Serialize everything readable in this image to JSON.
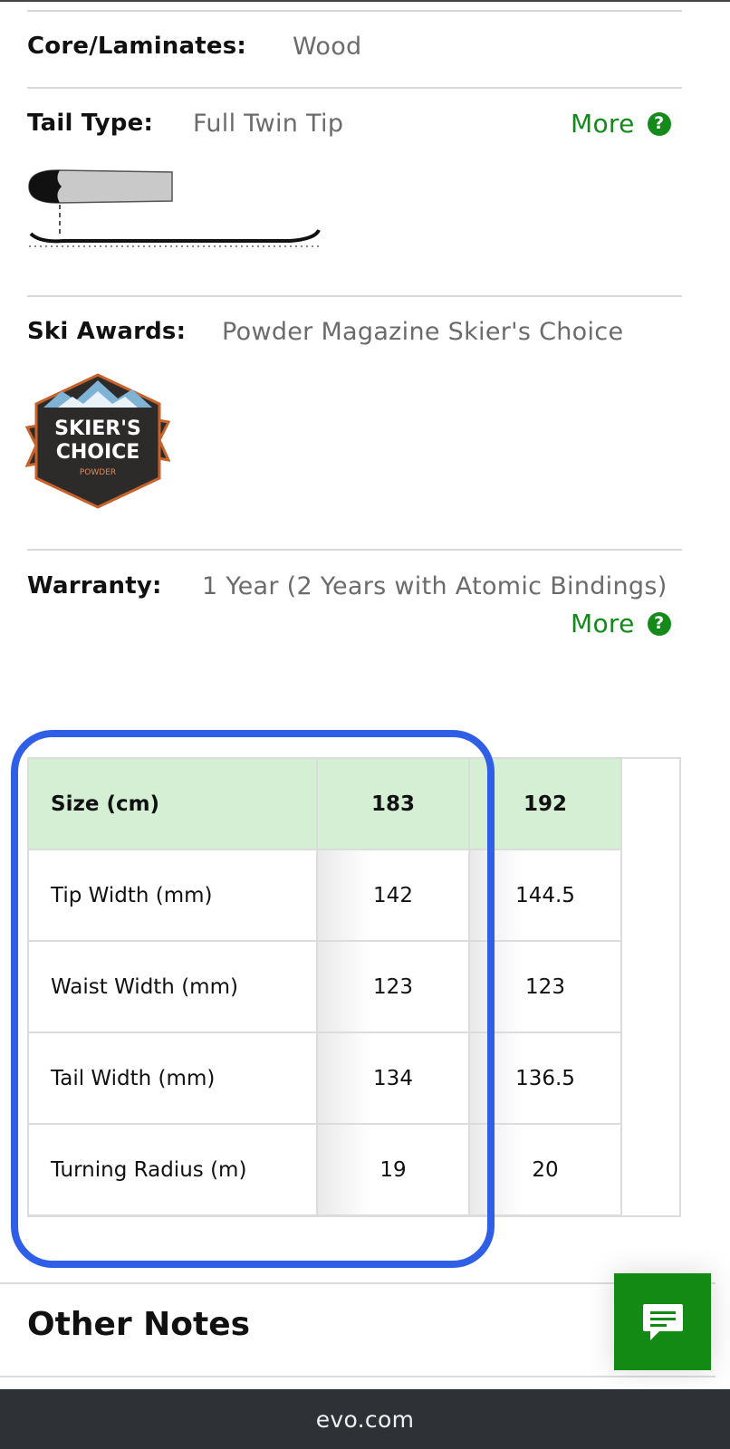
{
  "specs": {
    "core": {
      "label": "Core/Laminates:",
      "value": "Wood"
    },
    "tail": {
      "label": "Tail Type:",
      "value": "Full Twin Tip",
      "more": "More"
    },
    "awards": {
      "label": "Ski Awards:",
      "value": "Powder Magazine Skier's Choice",
      "badge_line1": "SKIER'S",
      "badge_line2": "CHOICE",
      "badge_small": "POWDER"
    },
    "warranty": {
      "label": "Warranty:",
      "value": "1 Year (2 Years with Atomic Bindings)",
      "more": "More"
    }
  },
  "help_glyph": "?",
  "size_table": {
    "header": {
      "label": "Size (cm)",
      "sizes": [
        "183",
        "192"
      ]
    },
    "rows": [
      {
        "label": "Tip Width (mm)",
        "values": [
          "142",
          "144.5"
        ]
      },
      {
        "label": "Waist Width (mm)",
        "values": [
          "123",
          "123"
        ]
      },
      {
        "label": "Tail Width (mm)",
        "values": [
          "134",
          "136.5"
        ]
      },
      {
        "label": "Turning Radius (m)",
        "values": [
          "19",
          "20"
        ]
      }
    ]
  },
  "other_notes": {
    "title": "Other Notes"
  },
  "footer": {
    "domain": "evo.com"
  },
  "colors": {
    "accent_green": "#138a1a",
    "header_green": "#d5efd5",
    "highlight_blue": "#2f5fe6",
    "footer_bg": "#2e3236"
  },
  "icons": {
    "chat": "chat-bubble-icon",
    "help": "question-circle-icon"
  }
}
